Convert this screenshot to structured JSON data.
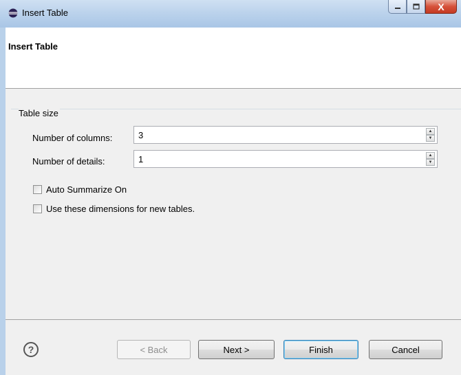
{
  "window": {
    "title": "Insert Table",
    "controls": {
      "minimize": "minimize",
      "maximize": "maximize",
      "close": "X"
    }
  },
  "header": {
    "title": "Insert Table"
  },
  "group": {
    "title": "Table size"
  },
  "fields": {
    "columns": {
      "label": "Number of columns:",
      "value": "3"
    },
    "details": {
      "label": "Number of details:",
      "value": "1"
    }
  },
  "options": {
    "auto_summarize": {
      "label": "Auto Summarize On",
      "checked": false
    },
    "use_dimensions": {
      "label": "Use these dimensions for new tables.",
      "checked": false
    }
  },
  "buttons": {
    "help": "?",
    "back": "< Back",
    "next": "Next >",
    "finish": "Finish",
    "cancel": "Cancel"
  }
}
